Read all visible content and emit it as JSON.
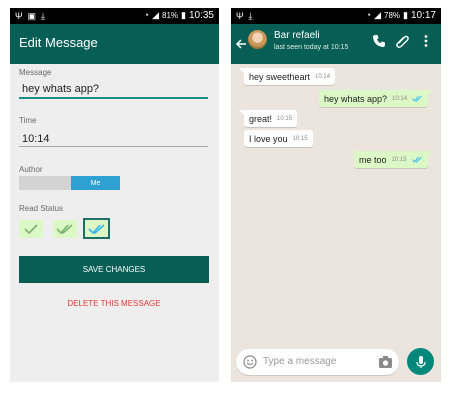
{
  "colors": {
    "teal_dark": "#075e54",
    "accent_teal": "#00897b",
    "chat_bg": "#ece5dd",
    "bubble_out": "#dcf8c6",
    "bubble_in": "#ffffff",
    "toggle_blue": "#2ea0d2",
    "delete_red": "#e53935",
    "tick_blue": "#34b7f1"
  },
  "left": {
    "statusbar": {
      "icons": [
        "usb-icon",
        "image-icon",
        "download-icon"
      ],
      "battery_pct": "81%",
      "time": "10:35"
    },
    "appbar": {
      "title": "Edit Message"
    },
    "form": {
      "message_label": "Message",
      "message_value": "hey whats app?",
      "time_label": "Time",
      "time_value": "10:14",
      "author_label": "Author",
      "author_option": "Me",
      "read_status_label": "Read Status",
      "read_status_options": [
        "single-check",
        "double-check",
        "double-check-read"
      ],
      "selected_read_status": "double-check-read",
      "save_label": "SAVE CHANGES",
      "delete_label": "DELETE THIS MESSAGE"
    }
  },
  "right": {
    "statusbar": {
      "icons": [
        "usb-icon",
        "download-icon"
      ],
      "battery_pct": "78%",
      "time": "10:17"
    },
    "header": {
      "contact_name": "Bar refaeli",
      "contact_status": "last seen today at 10:15"
    },
    "messages": [
      {
        "text": "hey sweetheart",
        "time": "10:14",
        "direction": "in"
      },
      {
        "text": "hey whats app?",
        "time": "10:14",
        "direction": "out",
        "ticks": "double-read"
      },
      {
        "text": "great!",
        "time": "10:15",
        "direction": "in"
      },
      {
        "text": "I love you",
        "time": "10:15",
        "direction": "in"
      },
      {
        "text": "me too",
        "time": "10:15",
        "direction": "out",
        "ticks": "double-read"
      }
    ],
    "composer": {
      "placeholder": "Type a message"
    }
  }
}
